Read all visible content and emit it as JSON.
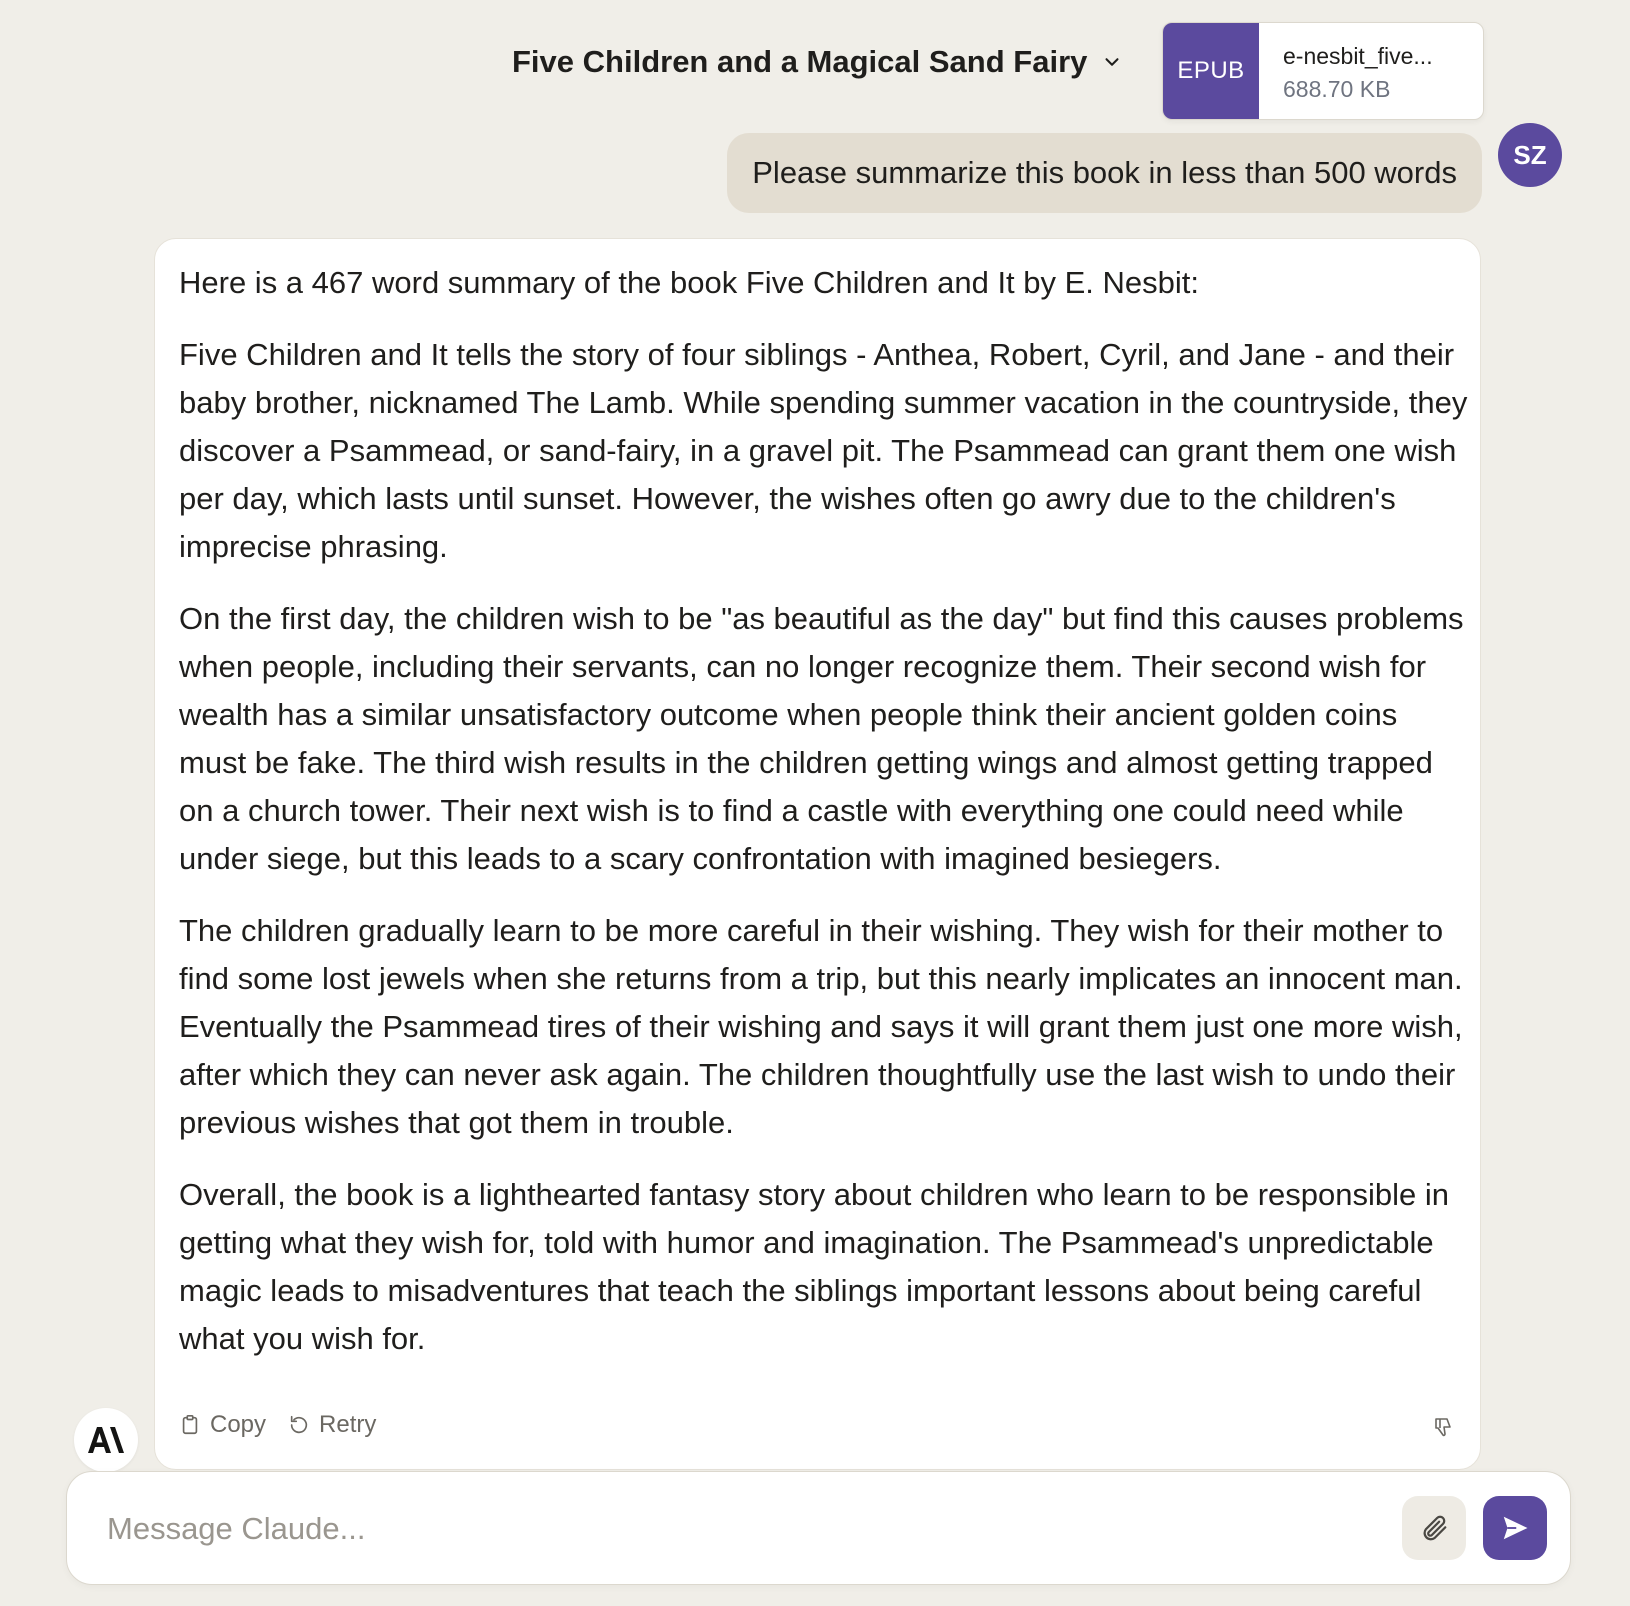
{
  "header": {
    "conversation_title": "Five Children and a Magical Sand Fairy",
    "attachment": {
      "type_badge": "EPUB",
      "file_name": "e-nesbit_five...",
      "file_size": "688.70 KB"
    }
  },
  "user": {
    "avatar_initials": "SZ",
    "message": "Please summarize this book in less than 500 words"
  },
  "assistant": {
    "paragraphs": [
      "Here is a 467 word summary of the book Five Children and It by E. Nesbit:",
      "Five Children and It tells the story of four siblings - Anthea, Robert, Cyril, and Jane - and their baby brother, nicknamed The Lamb. While spending summer vacation in the countryside, they discover a Psammead, or sand-fairy, in a gravel pit. The Psammead can grant them one wish per day, which lasts until sunset. However, the wishes often go awry due to the children's imprecise phrasing.",
      "On the first day, the children wish to be \"as beautiful as the day\" but find this causes problems when people, including their servants, can no longer recognize them. Their second wish for wealth has a similar unsatisfactory outcome when people think their ancient golden coins must be fake. The third wish results in the children getting wings and almost getting trapped on a church tower. Their next wish is to find a castle with everything one could need while under siege, but this leads to a scary confrontation with imagined besiegers.",
      "The children gradually learn to be more careful in their wishing. They wish for their mother to find some lost jewels when she returns from a trip, but this nearly implicates an innocent man. Eventually the Psammead tires of their wishing and says it will grant them just one more wish, after which they can never ask again. The children thoughtfully use the last wish to undo their previous wishes that got them in trouble.",
      "Overall, the book is a lighthearted fantasy story about children who learn to be responsible in getting what they wish for, told with humor and imagination. The Psammead's unpredictable magic leads to misadventures that teach the siblings important lessons about being careful what you wish for."
    ],
    "actions": {
      "copy_label": "Copy",
      "retry_label": "Retry"
    }
  },
  "composer": {
    "placeholder": "Message Claude..."
  },
  "colors": {
    "accent": "#5b4a9e",
    "background": "#f0eee8",
    "user_bubble": "#e3ddd1"
  }
}
